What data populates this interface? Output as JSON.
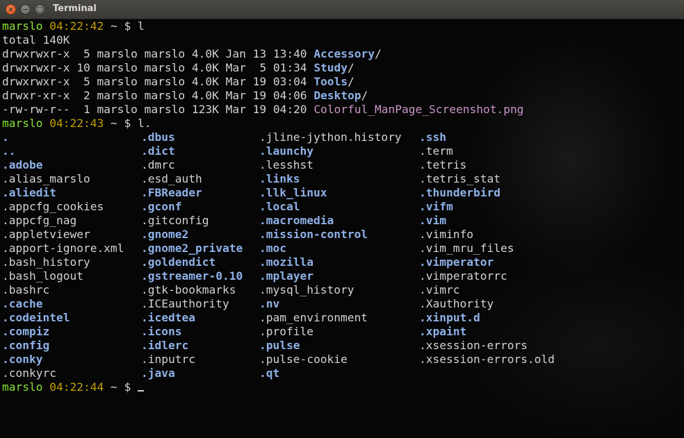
{
  "window": {
    "title": "Terminal"
  },
  "prompt": {
    "user": "marslo",
    "times": [
      "04:22:42",
      "04:22:43",
      "04:22:44"
    ],
    "path": "~",
    "symbol": "$"
  },
  "commands": [
    "l",
    "l."
  ],
  "listing": {
    "total": "total 140K",
    "rows": [
      {
        "meta": "drwxrwxr-x  5 marslo marslo 4.0K Jan 13 13:40 ",
        "name": "Accessory",
        "suffix": "/",
        "kind": "dir"
      },
      {
        "meta": "drwxrwxr-x 10 marslo marslo 4.0K Mar  5 01:34 ",
        "name": "Study",
        "suffix": "/",
        "kind": "dir"
      },
      {
        "meta": "drwxrwxr-x  5 marslo marslo 4.0K Mar 19 03:04 ",
        "name": "Tools",
        "suffix": "/",
        "kind": "dir"
      },
      {
        "meta": "drwxr-xr-x  2 marslo marslo 4.0K Mar 19 04:06 ",
        "name": "Desktop",
        "suffix": "/",
        "kind": "dir"
      },
      {
        "meta": "-rw-rw-r--  1 marslo marslo 123K Mar 19 04:20 ",
        "name": "Colorful_ManPage_Screenshot.png",
        "suffix": "",
        "kind": "img"
      }
    ]
  },
  "dotfiles": {
    "columns": [
      [
        {
          "t": ".",
          "d": true
        },
        {
          "t": "..",
          "d": true
        },
        {
          "t": ".adobe",
          "d": true
        },
        {
          "t": ".alias_marslo",
          "d": false
        },
        {
          "t": ".aliedit",
          "d": true
        },
        {
          "t": ".appcfg_cookies",
          "d": false
        },
        {
          "t": ".appcfg_nag",
          "d": false
        },
        {
          "t": ".appletviewer",
          "d": false
        },
        {
          "t": ".apport-ignore.xml",
          "d": false
        },
        {
          "t": ".bash_history",
          "d": false
        },
        {
          "t": ".bash_logout",
          "d": false
        },
        {
          "t": ".bashrc",
          "d": false
        },
        {
          "t": ".cache",
          "d": true
        },
        {
          "t": ".codeintel",
          "d": true
        },
        {
          "t": ".compiz",
          "d": true
        },
        {
          "t": ".config",
          "d": true
        },
        {
          "t": ".conky",
          "d": true
        },
        {
          "t": ".conkyrc",
          "d": false
        }
      ],
      [
        {
          "t": ".dbus",
          "d": true
        },
        {
          "t": ".dict",
          "d": true
        },
        {
          "t": ".dmrc",
          "d": false
        },
        {
          "t": ".esd_auth",
          "d": false
        },
        {
          "t": ".FBReader",
          "d": true
        },
        {
          "t": ".gconf",
          "d": true
        },
        {
          "t": ".gitconfig",
          "d": false
        },
        {
          "t": ".gnome2",
          "d": true
        },
        {
          "t": ".gnome2_private",
          "d": true
        },
        {
          "t": ".goldendict",
          "d": true
        },
        {
          "t": ".gstreamer-0.10",
          "d": true
        },
        {
          "t": ".gtk-bookmarks",
          "d": false
        },
        {
          "t": ".ICEauthority",
          "d": false
        },
        {
          "t": ".icedtea",
          "d": true
        },
        {
          "t": ".icons",
          "d": true
        },
        {
          "t": ".idlerc",
          "d": true
        },
        {
          "t": ".inputrc",
          "d": false
        },
        {
          "t": ".java",
          "d": true
        }
      ],
      [
        {
          "t": ".jline-jython.history",
          "d": false
        },
        {
          "t": ".launchy",
          "d": true
        },
        {
          "t": ".lesshst",
          "d": false
        },
        {
          "t": ".links",
          "d": true
        },
        {
          "t": ".llk_linux",
          "d": true
        },
        {
          "t": ".local",
          "d": true
        },
        {
          "t": ".macromedia",
          "d": true
        },
        {
          "t": ".mission-control",
          "d": true
        },
        {
          "t": ".moc",
          "d": true
        },
        {
          "t": ".mozilla",
          "d": true
        },
        {
          "t": ".mplayer",
          "d": true
        },
        {
          "t": ".mysql_history",
          "d": false
        },
        {
          "t": ".nv",
          "d": true
        },
        {
          "t": ".pam_environment",
          "d": false
        },
        {
          "t": ".profile",
          "d": false
        },
        {
          "t": ".pulse",
          "d": true
        },
        {
          "t": ".pulse-cookie",
          "d": false
        },
        {
          "t": ".qt",
          "d": true
        }
      ],
      [
        {
          "t": ".ssh",
          "d": true
        },
        {
          "t": ".term",
          "d": false
        },
        {
          "t": ".tetris",
          "d": false
        },
        {
          "t": ".tetris_stat",
          "d": false
        },
        {
          "t": ".thunderbird",
          "d": true
        },
        {
          "t": ".vifm",
          "d": true
        },
        {
          "t": ".vim",
          "d": true
        },
        {
          "t": ".viminfo",
          "d": false
        },
        {
          "t": ".vim_mru_files",
          "d": false
        },
        {
          "t": ".vimperator",
          "d": true
        },
        {
          "t": ".vimperatorrc",
          "d": false
        },
        {
          "t": ".vimrc",
          "d": false
        },
        {
          "t": ".Xauthority",
          "d": false
        },
        {
          "t": ".xinput.d",
          "d": true
        },
        {
          "t": ".xpaint",
          "d": true
        },
        {
          "t": ".xsession-errors",
          "d": false
        },
        {
          "t": ".xsession-errors.old",
          "d": false
        }
      ]
    ]
  },
  "colors": {
    "user": "#8ae234",
    "time": "#c4a000",
    "dir": "#8fb1e8",
    "image": "#c996c8",
    "text": "#d3d3d3"
  },
  "icons": {
    "close": "close-icon",
    "minimize": "minimize-icon",
    "maximize": "maximize-icon"
  }
}
